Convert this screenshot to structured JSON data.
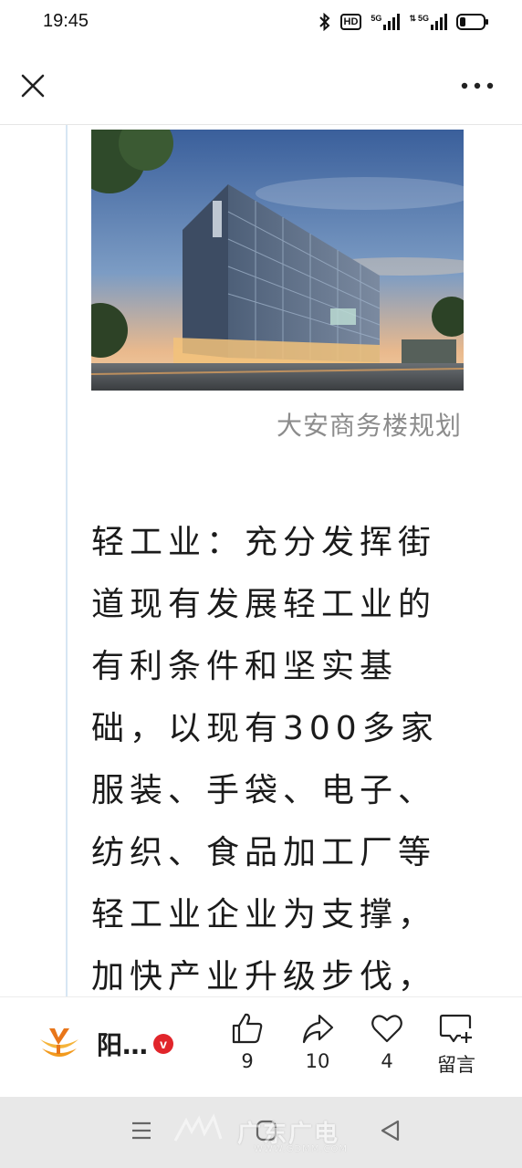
{
  "status_bar": {
    "time": "19:45",
    "hd_label": "HD",
    "signal1_label": "5G",
    "signal2_label": "5G"
  },
  "top_bar": {
    "close_icon": "close-icon",
    "more_icon": "more-icon"
  },
  "article": {
    "image_caption": "大安商务楼规划",
    "paragraph_lines": [
      "轻工业：充分发挥街",
      "道现有发展轻工业的",
      "有利条件和坚实基",
      "础，以现有300多家",
      "服装、手袋、电子、",
      "纺织、食品加工厂等",
      "轻工业企业为支撑，",
      "加快产业升级步伐，"
    ]
  },
  "action_bar": {
    "account_name": "阳…",
    "verified_mark": "v",
    "like_count": "9",
    "share_count": "10",
    "favorite_count": "4",
    "comment_label": "留言"
  },
  "watermark": {
    "text": "广东广电",
    "url": "WWW.GDMM.COM"
  },
  "colors": {
    "verified_red": "#e1252b",
    "logo_orange": "#f29a1d",
    "quote_line": "#d7e6f3"
  }
}
